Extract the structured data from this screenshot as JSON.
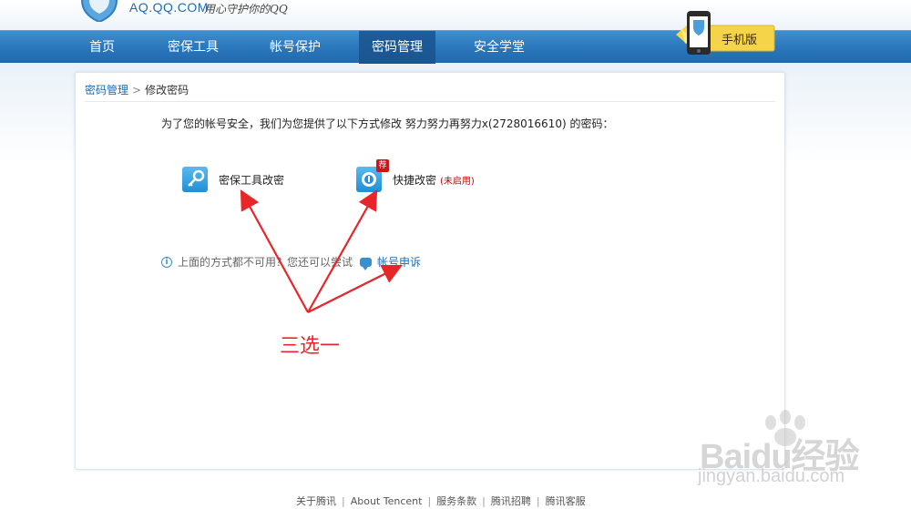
{
  "header": {
    "domain": "AQ.QQ.COM",
    "slogan": "用心守护你的QQ",
    "mobile_badge": "手机版"
  },
  "nav": {
    "items": [
      {
        "label": "首页",
        "active": false
      },
      {
        "label": "密保工具",
        "active": false
      },
      {
        "label": "帐号保护",
        "active": false
      },
      {
        "label": "密码管理",
        "active": true
      },
      {
        "label": "安全学堂",
        "active": false
      }
    ]
  },
  "breadcrumb": {
    "parent": "密码管理",
    "separator": ">",
    "current": "修改密码"
  },
  "intro_text": "为了您的帐号安全，我们为您提供了以下方式修改 努力努力再努力x(2728016610) 的密码：",
  "options": [
    {
      "label": "密保工具改密",
      "icon": "key-icon"
    },
    {
      "label": "快捷改密",
      "status": "(未启用)",
      "badge": "荐",
      "icon": "lock-icon"
    }
  ],
  "hint": {
    "text": "上面的方式都不可用？您还可以尝试",
    "link": "帐号申诉"
  },
  "annotation": "三选一",
  "footer": {
    "links": [
      "关于腾讯",
      "About Tencent",
      "服务条款",
      "腾讯招聘",
      "腾讯客服"
    ]
  },
  "watermark": {
    "brand": "Baidu经验",
    "url": "jingyan.baidu.com"
  },
  "colors": {
    "nav_blue": "#2a76bb",
    "link_blue": "#1f6bb3",
    "annotation_red": "#e8262a"
  }
}
